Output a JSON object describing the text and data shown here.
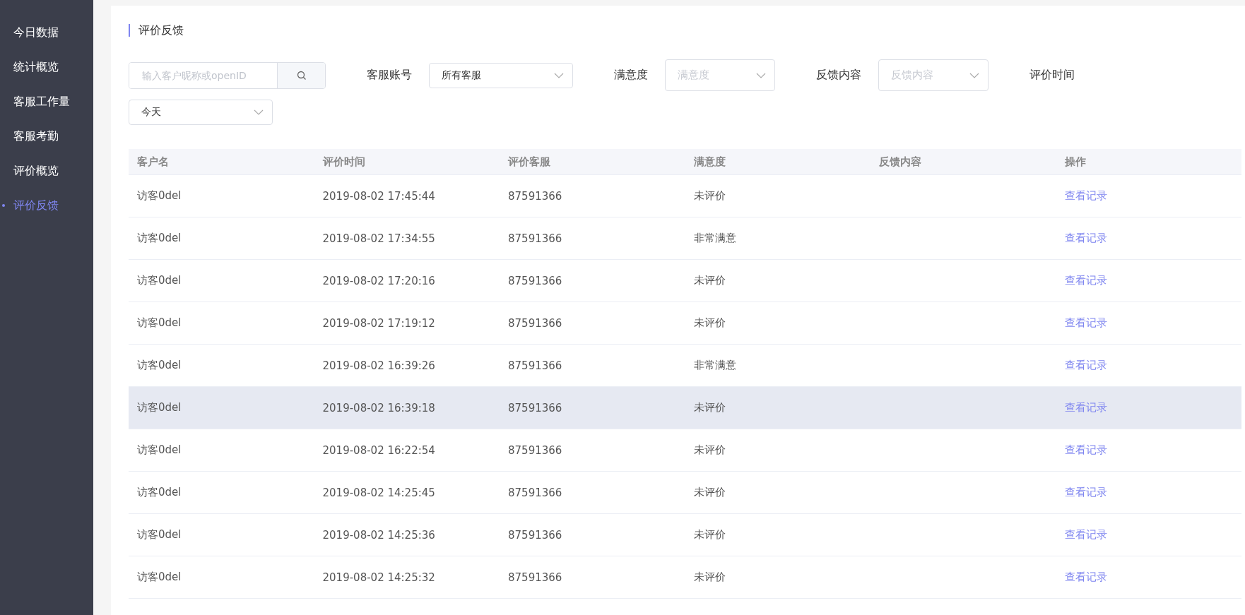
{
  "sidebar": {
    "items": [
      {
        "label": "今日数据",
        "selected": false
      },
      {
        "label": "统计概览",
        "selected": false
      },
      {
        "label": "客服工作量",
        "selected": false
      },
      {
        "label": "客服考勤",
        "selected": false
      },
      {
        "label": "评价概览",
        "selected": false
      },
      {
        "label": "评价反馈",
        "selected": true
      }
    ]
  },
  "page_title": "评价反馈",
  "filters": {
    "search": {
      "placeholder": "输入客户昵称或openID"
    },
    "fields": [
      {
        "label": "客服账号",
        "value": "所有客服"
      },
      {
        "label": "满意度",
        "placeholder": "满意度"
      },
      {
        "label": "反馈内容",
        "placeholder": "反馈内容"
      },
      {
        "label": "评价时间",
        "value": "今天"
      }
    ]
  },
  "table": {
    "columns": [
      "客户名",
      "评价时间",
      "评价客服",
      "满意度",
      "反馈内容",
      "操作"
    ],
    "rows": [
      {
        "cells": [
          "访客0del",
          "2019-08-02 17:45:44",
          "87591366",
          "未评价",
          ""
        ],
        "action": "查看记录",
        "selected": false
      },
      {
        "cells": [
          "访客0del",
          "2019-08-02 17:34:55",
          "87591366",
          "非常满意",
          ""
        ],
        "action": "查看记录",
        "selected": false
      },
      {
        "cells": [
          "访客0del",
          "2019-08-02 17:20:16",
          "87591366",
          "未评价",
          ""
        ],
        "action": "查看记录",
        "selected": false
      },
      {
        "cells": [
          "访客0del",
          "2019-08-02 17:19:12",
          "87591366",
          "未评价",
          ""
        ],
        "action": "查看记录",
        "selected": false
      },
      {
        "cells": [
          "访客0del",
          "2019-08-02 16:39:26",
          "87591366",
          "非常满意",
          ""
        ],
        "action": "查看记录",
        "selected": false
      },
      {
        "cells": [
          "访客0del",
          "2019-08-02 16:39:18",
          "87591366",
          "未评价",
          ""
        ],
        "action": "查看记录",
        "selected": true
      },
      {
        "cells": [
          "访客0del",
          "2019-08-02 16:22:54",
          "87591366",
          "未评价",
          ""
        ],
        "action": "查看记录",
        "selected": false
      },
      {
        "cells": [
          "访客0del",
          "2019-08-02 14:25:45",
          "87591366",
          "未评价",
          ""
        ],
        "action": "查看记录",
        "selected": false
      },
      {
        "cells": [
          "访客0del",
          "2019-08-02 14:25:36",
          "87591366",
          "未评价",
          ""
        ],
        "action": "查看记录",
        "selected": false
      },
      {
        "cells": [
          "访客0del",
          "2019-08-02 14:25:32",
          "87591366",
          "未评价",
          ""
        ],
        "action": "查看记录",
        "selected": false
      }
    ]
  }
}
